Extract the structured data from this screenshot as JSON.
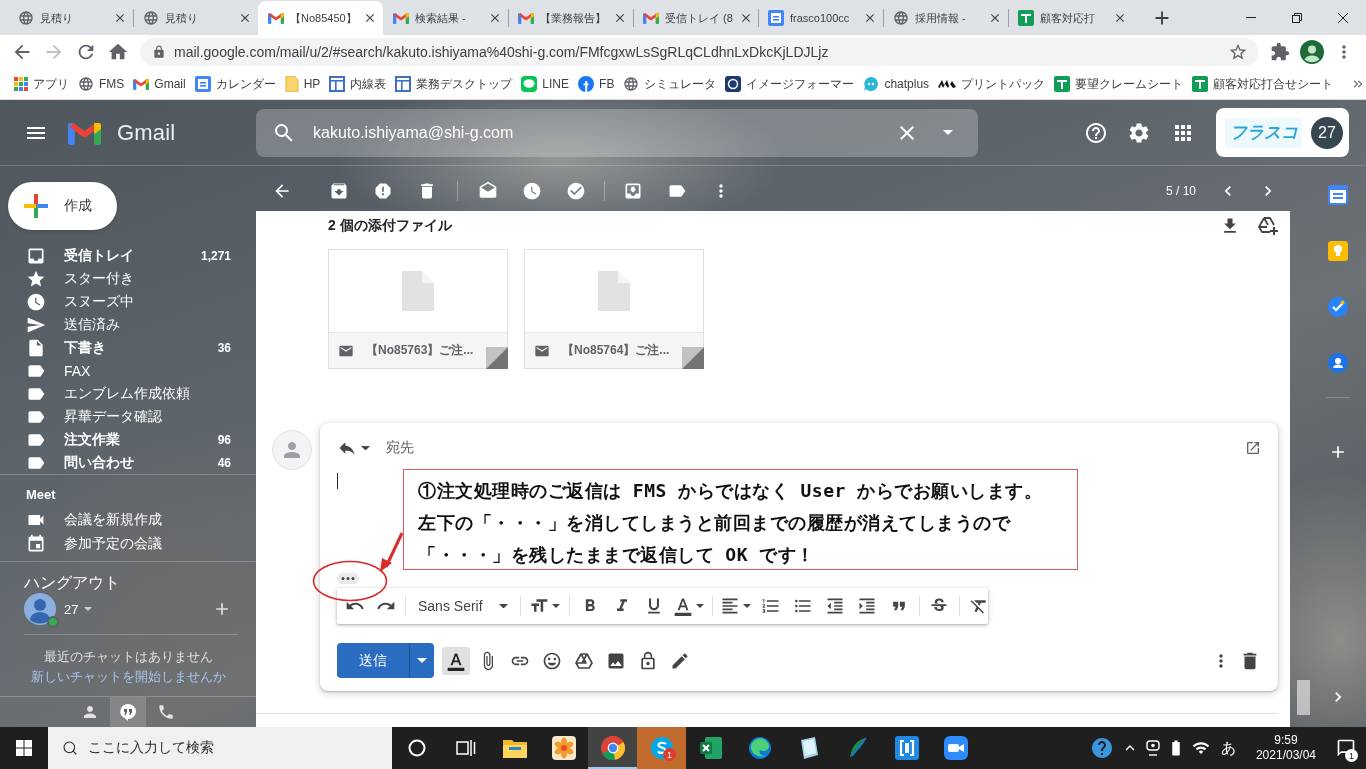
{
  "browser": {
    "tabs": [
      {
        "title": "見積り",
        "kind": "web",
        "selected": false
      },
      {
        "title": "見積り",
        "kind": "web",
        "selected": false
      },
      {
        "title": "【No85450】",
        "kind": "gmail",
        "selected": true
      },
      {
        "title": "検索結果 -",
        "kind": "gmail",
        "selected": false
      },
      {
        "title": "【業務報告】",
        "kind": "gmail",
        "selected": false
      },
      {
        "title": "受信トレイ (8",
        "kind": "gmail",
        "selected": false
      },
      {
        "title": "frasco100cc",
        "kind": "calendar",
        "selected": false
      },
      {
        "title": "採用情報 -",
        "kind": "web",
        "selected": false
      },
      {
        "title": "顧客対応打",
        "kind": "sheets",
        "selected": false
      }
    ],
    "nav_buttons": [
      {
        "kind": "back",
        "disabled": false
      },
      {
        "kind": "forward",
        "disabled": true
      },
      {
        "kind": "reload",
        "disabled": false
      },
      {
        "kind": "home",
        "disabled": false
      }
    ],
    "url": "mail.google.com/mail/u/2/#search/kakuto.ishiyama%40shi-g.com/FMfcgxwLsSgRLqCLdhnLxDkcKjLDJLjz",
    "bookmarks": [
      {
        "label": "アプリ",
        "kind": "apps"
      },
      {
        "label": "FMS",
        "kind": "web"
      },
      {
        "label": "Gmail",
        "kind": "gmail"
      },
      {
        "label": "カレンダー",
        "kind": "calendar"
      },
      {
        "label": "HP",
        "kind": "folder"
      },
      {
        "label": "内線表",
        "kind": "layout"
      },
      {
        "label": "業務デスクトップ",
        "kind": "layout"
      },
      {
        "label": "LINE",
        "kind": "line"
      },
      {
        "label": "FB",
        "kind": "facebook"
      },
      {
        "label": "シミュレータ",
        "kind": "web"
      },
      {
        "label": "イメージフォーマー",
        "kind": "imageformer"
      },
      {
        "label": "chatplus",
        "kind": "chatplus"
      },
      {
        "label": "プリントパック",
        "kind": "printpac"
      },
      {
        "label": "要望クレームシート",
        "kind": "sheets"
      },
      {
        "label": "顧客対応打合せシート",
        "kind": "sheets"
      }
    ]
  },
  "gmail": {
    "logo": "Gmail",
    "search": {
      "value": "kakuto.ishiyama@shi-g.com"
    },
    "account": {
      "logo": "フラスコ",
      "avatar": "27"
    },
    "compose": "作成",
    "nav": [
      {
        "label": "受信トレイ",
        "count": "1,271",
        "kind": "inbox",
        "unread": true
      },
      {
        "label": "スター付き",
        "kind": "starred",
        "unread": false
      },
      {
        "label": "スヌーズ中",
        "kind": "snoozed",
        "unread": false
      },
      {
        "label": "送信済み",
        "kind": "sent",
        "unread": false
      },
      {
        "label": "下書き",
        "count": "36",
        "kind": "drafts",
        "unread": true
      },
      {
        "label": "FAX",
        "kind": "label",
        "unread": false
      },
      {
        "label": "エンブレム作成依頼",
        "kind": "label",
        "unread": false
      },
      {
        "label": "昇華データ確認",
        "kind": "label",
        "unread": false
      },
      {
        "label": "注文作業",
        "count": "96",
        "kind": "label",
        "unread": true
      },
      {
        "label": "問い合わせ",
        "count": "46",
        "kind": "label",
        "unread": true
      }
    ],
    "meet": {
      "title": "Meet",
      "items": [
        {
          "label": "会議を新規作成",
          "kind": "new"
        },
        {
          "label": "参加予定の会議",
          "kind": "join"
        }
      ]
    },
    "hangouts": {
      "title": "ハングアウト",
      "user": "27",
      "online": true,
      "empty": "最近のチャットはありません",
      "start": "新しいチャットを開始しませんか",
      "tabs": [
        {
          "kind": "contacts",
          "selected": false
        },
        {
          "kind": "chat",
          "selected": true
        },
        {
          "kind": "phone",
          "selected": false
        }
      ]
    },
    "pager": "5 / 10",
    "attachments": {
      "title": "2 個の添付ファイル",
      "files": [
        {
          "name": "【No85763】ご注..."
        },
        {
          "name": "【No85764】ご注..."
        }
      ]
    },
    "reply": {
      "to_label": "宛先",
      "font": "Sans Serif",
      "send": "送信",
      "formatting_open": true
    },
    "annotation": {
      "lines": [
        "①注文処理時のご返信は FMS からではなく User からでお願いします。",
        "左下の「・・・」を消してしまうと前回までの履歴が消えてしまうので",
        "「・・・」を残したままで返信して OK です！"
      ]
    }
  },
  "taskbar": {
    "search_placeholder": "ここに入力して検索",
    "apps": [
      {
        "kind": "cortana",
        "selected": false,
        "flashing": false
      },
      {
        "kind": "taskview",
        "selected": false,
        "flashing": false
      },
      {
        "kind": "explorer",
        "selected": false,
        "flashing": false
      },
      {
        "kind": "photo",
        "selected": false,
        "flashing": false
      },
      {
        "kind": "chrome",
        "selected": true,
        "flashing": false
      },
      {
        "kind": "skype",
        "selected": false,
        "flashing": true,
        "badge": "1"
      },
      {
        "kind": "excel",
        "selected": false,
        "flashing": false
      },
      {
        "kind": "edge",
        "selected": false,
        "flashing": false
      },
      {
        "kind": "paper",
        "selected": false,
        "flashing": false
      },
      {
        "kind": "feather",
        "selected": false,
        "flashing": false
      },
      {
        "kind": "bracket",
        "selected": false,
        "flashing": false
      },
      {
        "kind": "zoom",
        "selected": false,
        "flashing": false
      }
    ],
    "ime": "あ",
    "time": "9:59",
    "date": "2021/03/04",
    "notifications": "1"
  }
}
